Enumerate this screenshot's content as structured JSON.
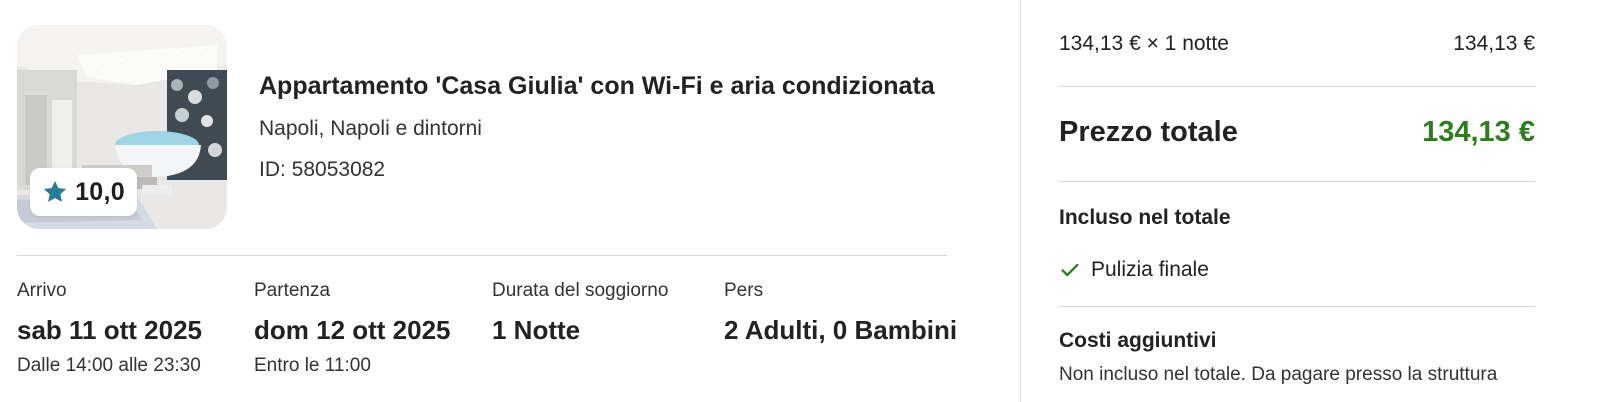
{
  "listing": {
    "rating": "10,0",
    "title": "Appartamento 'Casa Giulia' con Wi-Fi e aria condizionata",
    "location": "Napoli, Napoli e dintorni",
    "id_text": "ID: 58053082"
  },
  "stay": {
    "checkin": {
      "label": "Arrivo",
      "value": "sab 11 ott 2025",
      "sub": "Dalle 14:00 alle 23:30"
    },
    "checkout": {
      "label": "Partenza",
      "value": "dom 12 ott 2025",
      "sub": "Entro le 11:00"
    },
    "duration": {
      "label": "Durata del soggiorno",
      "value": "1 Notte"
    },
    "guests": {
      "label": "Pers",
      "value": "2 Adulti, 0 Bambini"
    }
  },
  "price": {
    "nightly_label": "134,13 € × 1 notte",
    "nightly_amount": "134,13 €",
    "total_label": "Prezzo totale",
    "total_amount": "134,13 €",
    "included_title": "Incluso nel totale",
    "included_items": [
      "Pulizia finale"
    ],
    "extra_title": "Costi aggiuntivi",
    "extra_note": "Non incluso nel totale. Da pagare presso la struttura"
  },
  "colors": {
    "accent_total": "#2e7d1f",
    "check": "#2e7d1f",
    "star": "#2b7a99"
  },
  "icons": {
    "star": "star-icon",
    "check": "check-icon"
  }
}
